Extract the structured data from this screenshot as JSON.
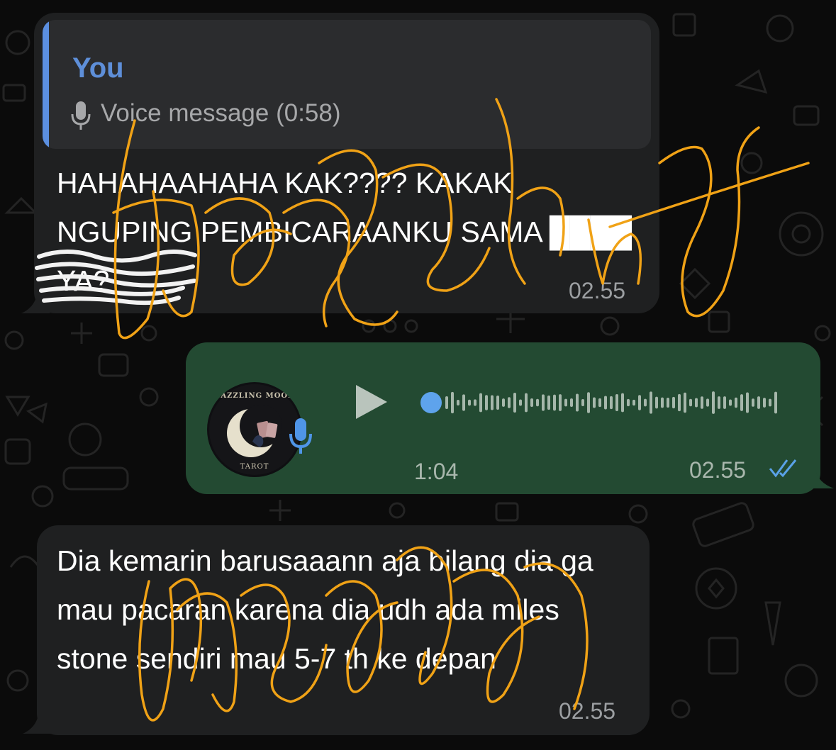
{
  "colors": {
    "incoming_bubble": "#1f2021",
    "outgoing_bubble": "#234a32",
    "quote_accent": "#5b8fe0",
    "read_ticks": "#5aa2e8",
    "scribble": "#f0a216"
  },
  "messages": [
    {
      "direction": "incoming",
      "reply_to": {
        "author": "You",
        "icon": "mic-icon",
        "text": "Voice message (0:58)"
      },
      "text": "HAHAHAAHAHA KAK???? KAKAK NGUPING PEMBICARAANKU SAMA ████ YA?",
      "time": "02.55"
    },
    {
      "direction": "outgoing",
      "type": "voice",
      "avatar_text_top": "DAZZLING MOON",
      "avatar_text_bottom": "TAROT",
      "duration": "1:04",
      "progress": 0,
      "time": "02.55",
      "status_icon": "double-check-icon",
      "status": "read"
    },
    {
      "direction": "incoming",
      "text": "Dia kemarin barusaaann aja bilang dia ga mau pacaran karena dia udh ada miles stone sendiri mau 5-7 th ke depan",
      "time": "02.55"
    }
  ]
}
